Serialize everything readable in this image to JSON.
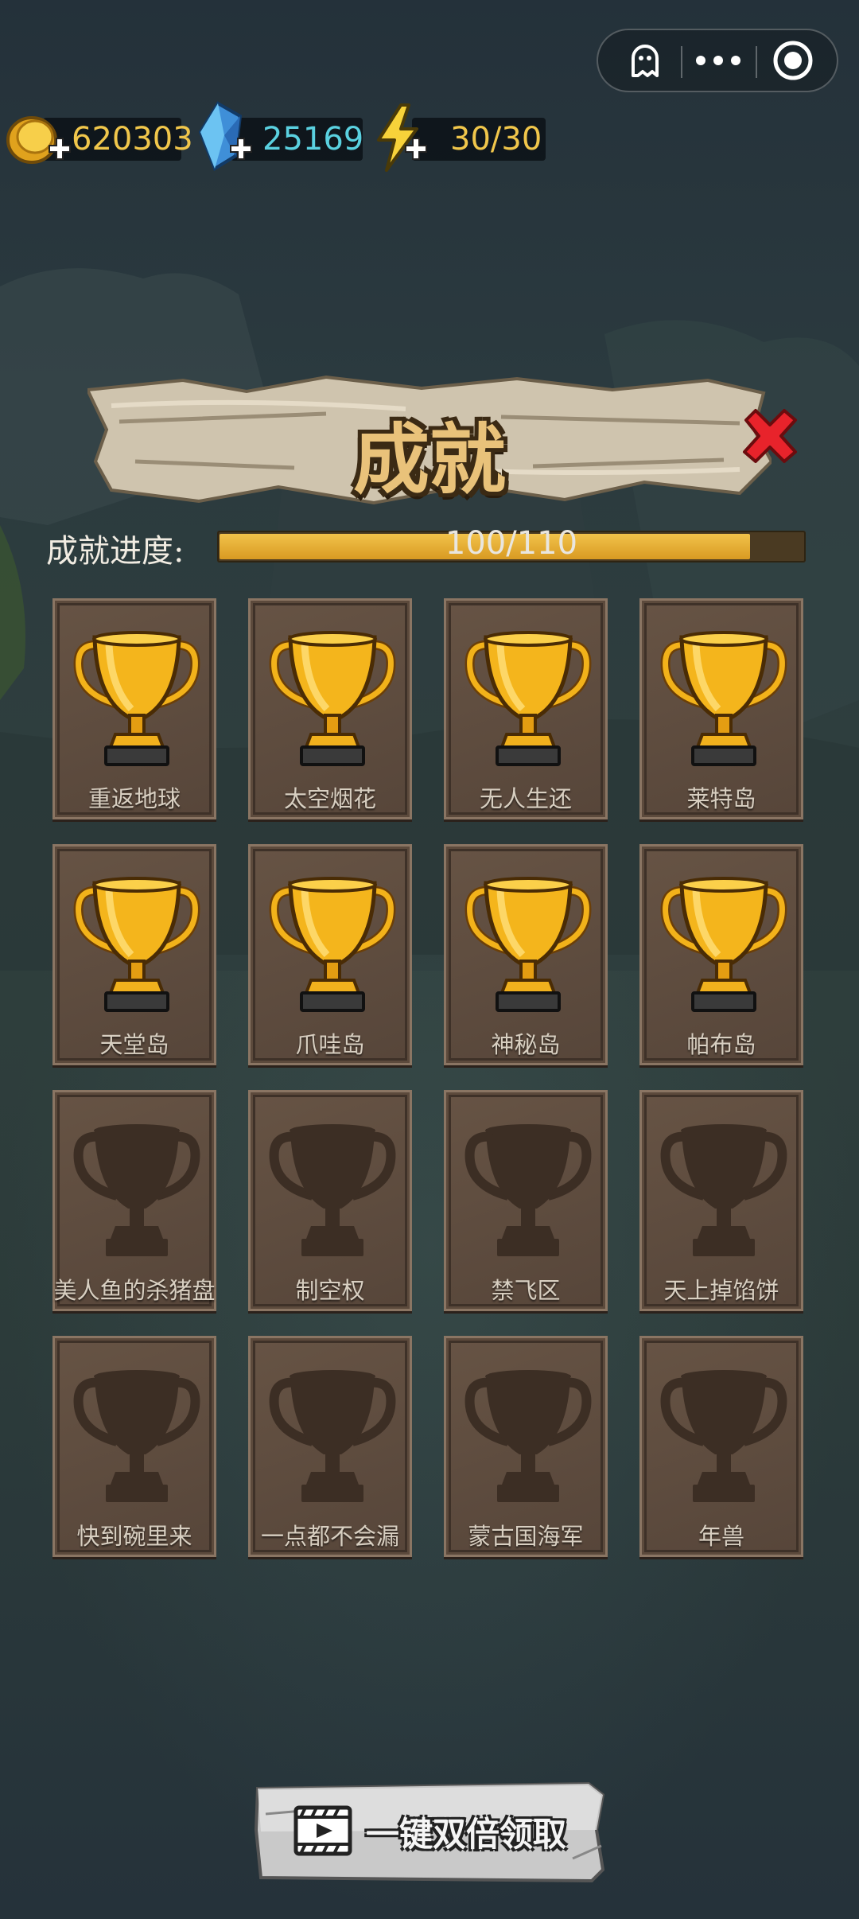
{
  "capsule": {
    "icons": [
      "ghost-icon",
      "more-dots-icon",
      "record-circle-icon"
    ]
  },
  "resources": [
    {
      "name": "gold",
      "icon": "gold-coin-icon",
      "value": "620303",
      "color": "#f0c64b"
    },
    {
      "name": "crystal",
      "icon": "blue-crystal-icon",
      "value": "25169",
      "color": "#5ad1e0"
    },
    {
      "name": "energy",
      "icon": "lightning-icon",
      "value": "30/30",
      "color": "#f0c64b"
    }
  ],
  "title": "成就",
  "progress": {
    "label": "成就进度:",
    "text": "100/110",
    "current": 100,
    "total": 110
  },
  "achievements": [
    {
      "name": "重返地球",
      "unlocked": true
    },
    {
      "name": "太空烟花",
      "unlocked": true
    },
    {
      "name": "无人生还",
      "unlocked": true
    },
    {
      "name": "莱特岛",
      "unlocked": true
    },
    {
      "name": "天堂岛",
      "unlocked": true
    },
    {
      "name": "爪哇岛",
      "unlocked": true
    },
    {
      "name": "神秘岛",
      "unlocked": true
    },
    {
      "name": "帕布岛",
      "unlocked": true
    },
    {
      "name": "美人鱼的杀猪盘",
      "unlocked": false
    },
    {
      "name": "制空权",
      "unlocked": false
    },
    {
      "name": "禁飞区",
      "unlocked": false
    },
    {
      "name": "天上掉馅饼",
      "unlocked": false
    },
    {
      "name": "快到碗里来",
      "unlocked": false
    },
    {
      "name": "一点都不会漏",
      "unlocked": false
    },
    {
      "name": "蒙古国海军",
      "unlocked": false
    },
    {
      "name": "年兽",
      "unlocked": false
    }
  ],
  "claim_button": {
    "label": "一键双倍领取",
    "icon": "video-film-icon"
  }
}
